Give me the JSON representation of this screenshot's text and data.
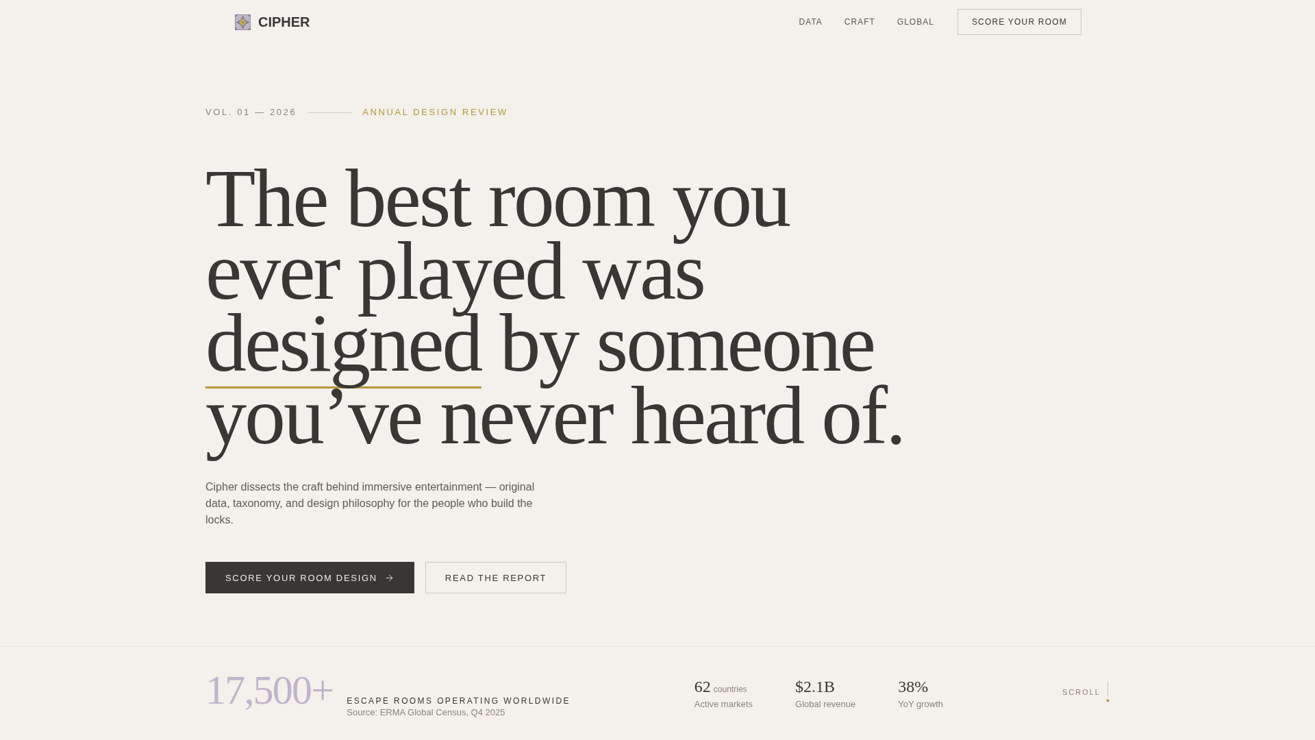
{
  "header": {
    "brand": "CIPHER",
    "nav": [
      {
        "label": "DATA"
      },
      {
        "label": "CRAFT"
      },
      {
        "label": "GLOBAL"
      }
    ],
    "cta": "SCORE YOUR ROOM"
  },
  "hero": {
    "eyebrow": {
      "issue": "VOL. 01 — 2026",
      "section": "ANNUAL DESIGN REVIEW"
    },
    "headline": [
      {
        "text": "The best room you ever played was ",
        "underlined": false
      },
      {
        "text": "designed",
        "underlined": true
      },
      {
        "text": " by someone you’ve never heard of.",
        "underlined": false
      }
    ],
    "intro": "Cipher dissects the craft behind immersive entertainment — original data, taxonomy, and design philosophy for the people who build the locks.",
    "buttons": [
      {
        "label": "SCORE YOUR ROOM DESIGN",
        "kind": "primary"
      },
      {
        "label": "READ THE REPORT",
        "kind": "secondary"
      }
    ]
  },
  "stats_bar": {
    "headline_stat": {
      "value": "17,500+",
      "label": "ESCAPE ROOMS OPERATING WORLDWIDE",
      "source": "Source: ERMA Global Census, Q4 2025"
    },
    "stats": [
      {
        "value": "62",
        "unit": "countries",
        "label": "Active markets"
      },
      {
        "value": "$2.1B",
        "label": "Global revenue"
      },
      {
        "value": "38%",
        "label": "YoY growth"
      }
    ],
    "scroll_hint": "SCROLL"
  }
}
